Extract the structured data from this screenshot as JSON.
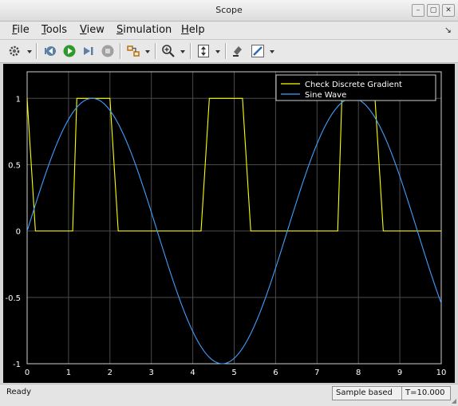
{
  "window": {
    "title": "Scope"
  },
  "menu": {
    "items": [
      {
        "label": "File",
        "u": "F",
        "rest": "ile"
      },
      {
        "label": "Tools",
        "u": "T",
        "rest": "ools"
      },
      {
        "label": "View",
        "u": "V",
        "rest": "iew"
      },
      {
        "label": "Simulation",
        "u": "S",
        "rest": "imulation"
      },
      {
        "label": "Help",
        "u": "H",
        "rest": "elp"
      }
    ]
  },
  "toolbar": {
    "icons": [
      "gear-icon",
      "step-back-icon",
      "run-icon",
      "step-forward-icon",
      "stop-icon",
      "signal-select-icon",
      "zoom-in-icon",
      "autoscale-icon",
      "highlight-icon",
      "style-pen-icon"
    ]
  },
  "status": {
    "ready": "Ready",
    "mode": "Sample based",
    "time": "T=10.000"
  },
  "chart_data": {
    "type": "line",
    "xlim": [
      0,
      10
    ],
    "ylim": [
      -1,
      1.2
    ],
    "xticks": [
      0,
      1,
      2,
      3,
      4,
      5,
      6,
      7,
      8,
      9,
      10
    ],
    "yticks": [
      -1,
      -0.5,
      0,
      0.5,
      1
    ],
    "ytick_labels": [
      "-1",
      "-0.5",
      "0",
      "0.5",
      "1"
    ],
    "grid": true,
    "legend_position": "top-right",
    "series": [
      {
        "name": "Check Discrete Gradient",
        "color": "#ffff00",
        "x": [
          0,
          0.2,
          1.1,
          1.2,
          2.0,
          2.2,
          4.2,
          4.4,
          5.2,
          5.4,
          7.5,
          7.6,
          8.4,
          8.6,
          10
        ],
        "y": [
          1,
          0,
          0,
          1,
          1,
          0,
          0,
          1,
          1,
          0,
          0,
          1,
          1,
          0,
          0
        ]
      },
      {
        "name": "Sine Wave",
        "color": "#3f9fff",
        "x": [
          0,
          0.5,
          1,
          1.5708,
          2,
          2.5,
          3,
          3.5,
          4,
          4.7124,
          5,
          5.5,
          6,
          6.5,
          7,
          7.5,
          7.854,
          8.5,
          9,
          9.5,
          10
        ],
        "y": [
          0,
          0.479,
          0.841,
          1,
          0.909,
          0.598,
          0.141,
          -0.351,
          -0.757,
          -1,
          -0.959,
          -0.706,
          -0.279,
          0.215,
          0.657,
          0.938,
          1,
          0.798,
          0.412,
          -0.075,
          -0.544
        ]
      }
    ]
  }
}
